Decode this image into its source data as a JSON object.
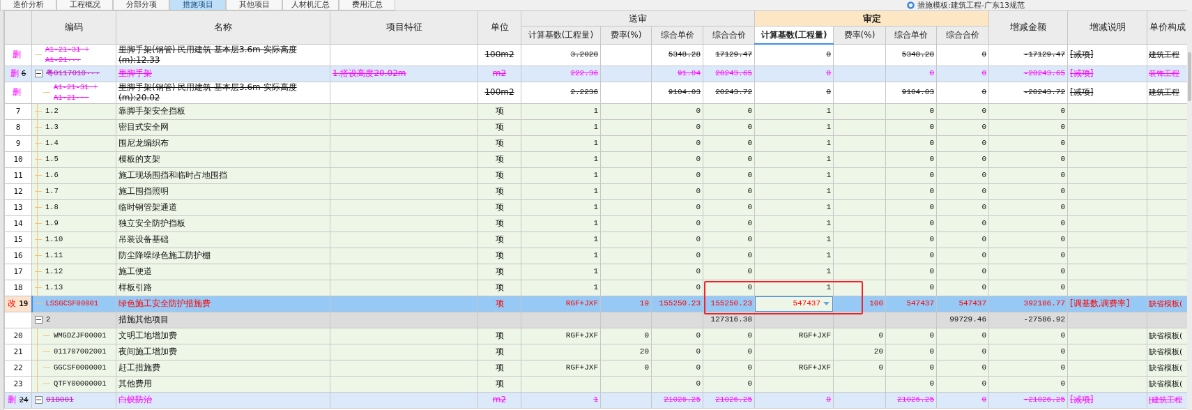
{
  "tabs": [
    {
      "label": "造价分析",
      "selected": false
    },
    {
      "label": "工程概况",
      "selected": false
    },
    {
      "label": "分部分项",
      "selected": false
    },
    {
      "label": "措施项目",
      "selected": true
    },
    {
      "label": "其他项目",
      "selected": false
    },
    {
      "label": "人材机汇总",
      "selected": false
    },
    {
      "label": "费用汇总",
      "selected": false
    }
  ],
  "template_label": "措施模板:建筑工程-广东13规范",
  "columns": [
    {
      "label": "编码"
    },
    {
      "label": "名称"
    },
    {
      "label": "项目特征"
    },
    {
      "label": "单位"
    },
    {
      "label": "送审",
      "highlighted": false,
      "subcolumns": [
        {
          "label": "计算基数(工程量)",
          "active": false
        },
        {
          "label": "费率(%)",
          "active": false
        },
        {
          "label": "综合单价",
          "active": false
        },
        {
          "label": "综合合价",
          "active": false
        }
      ]
    },
    {
      "label": "审定",
      "highlighted": true,
      "subcolumns": [
        {
          "label": "计算基数(工程量)",
          "active": true
        },
        {
          "label": "费率(%)",
          "active": false
        },
        {
          "label": "综合单价",
          "active": false
        },
        {
          "label": "综合合价",
          "active": false
        }
      ]
    },
    {
      "label": "增减金额"
    },
    {
      "label": "增减说明"
    },
    {
      "label": "单价构成"
    }
  ],
  "rows": [
    {
      "kind": "resource",
      "deleted": true,
      "modified": false,
      "mark": "删",
      "selected": false,
      "editing": false,
      "code": "A1-21-31 + A1-21···",
      "name": "里脚手架(钢管) 民用建筑 基本层3.6m  实际高度(m):12.33",
      "unit": "100m2",
      "submitted": {
        "base": "3.2028",
        "unit_price": "5348.28",
        "total": "17129.47"
      },
      "approved": {
        "base": "0",
        "unit_price": "5348.28",
        "total": "0"
      },
      "change": "-17129.47",
      "change_note": "[减项]",
      "price_composition": "建筑工程"
    },
    {
      "kind": "group",
      "deleted": true,
      "modified": false,
      "mark": "删",
      "number": "6",
      "selected": false,
      "editing": false,
      "expanded": true,
      "code": "粤0117010···",
      "name": "里脚手架",
      "feature": "1.搭设高度20.02m",
      "unit": "m2",
      "submitted": {
        "base": "222.36",
        "unit_price": "91.04",
        "total": "20243.65"
      },
      "approved": {
        "base": "0",
        "unit_price": "0",
        "total": "0"
      },
      "change": "-20243.65",
      "change_note": "[减项]",
      "price_composition": "装饰工程",
      "children": [
        {
          "kind": "resource",
          "deleted": true,
          "modified": false,
          "mark": "删",
          "selected": false,
          "editing": false,
          "code": "A1-21-31 + A1-21···",
          "name": "里脚手架(钢管) 民用建筑 基本层3.6m  实际高度(m):20.02",
          "unit": "100m2",
          "submitted": {
            "base": "2.2236",
            "unit_price": "9104.03",
            "total": "20243.72"
          },
          "approved": {
            "base": "0",
            "unit_price": "9104.03",
            "total": "0"
          },
          "change": "-20243.72",
          "change_note": "[减项]",
          "price_composition": "建筑工程"
        }
      ]
    },
    {
      "kind": "item",
      "deleted": false,
      "modified": false,
      "number": "7",
      "selected": false,
      "editing": false,
      "code": "1.2",
      "name": "靠脚手架安全挡板",
      "unit": "项",
      "submitted": {
        "base": "1",
        "unit_price": "0",
        "total": "0"
      },
      "approved": {
        "base": "1",
        "unit_price": "0",
        "total": "0"
      },
      "change": "0"
    },
    {
      "kind": "item",
      "deleted": false,
      "modified": false,
      "number": "8",
      "selected": false,
      "editing": false,
      "code": "1.3",
      "name": "密目式安全网",
      "unit": "项",
      "submitted": {
        "base": "1",
        "unit_price": "0",
        "total": "0"
      },
      "approved": {
        "base": "1",
        "unit_price": "0",
        "total": "0"
      },
      "change": "0"
    },
    {
      "kind": "item",
      "deleted": false,
      "modified": false,
      "number": "9",
      "selected": false,
      "editing": false,
      "code": "1.4",
      "name": "围尼龙编织布",
      "unit": "项",
      "submitted": {
        "base": "1",
        "unit_price": "0",
        "total": "0"
      },
      "approved": {
        "base": "1",
        "unit_price": "0",
        "total": "0"
      },
      "change": "0"
    },
    {
      "kind": "item",
      "deleted": false,
      "modified": false,
      "number": "10",
      "selected": false,
      "editing": false,
      "code": "1.5",
      "name": "模板的支架",
      "unit": "项",
      "submitted": {
        "base": "1",
        "unit_price": "0",
        "total": "0"
      },
      "approved": {
        "base": "1",
        "unit_price": "0",
        "total": "0"
      },
      "change": "0"
    },
    {
      "kind": "item",
      "deleted": false,
      "modified": false,
      "number": "11",
      "selected": false,
      "editing": false,
      "code": "1.6",
      "name": "施工现场围挡和临时占地围挡",
      "unit": "项",
      "submitted": {
        "base": "1",
        "unit_price": "0",
        "total": "0"
      },
      "approved": {
        "base": "1",
        "unit_price": "0",
        "total": "0"
      },
      "change": "0"
    },
    {
      "kind": "item",
      "deleted": false,
      "modified": false,
      "number": "12",
      "selected": false,
      "editing": false,
      "code": "1.7",
      "name": "施工围挡照明",
      "unit": "项",
      "submitted": {
        "base": "1",
        "unit_price": "0",
        "total": "0"
      },
      "approved": {
        "base": "1",
        "unit_price": "0",
        "total": "0"
      },
      "change": "0"
    },
    {
      "kind": "item",
      "deleted": false,
      "modified": false,
      "number": "13",
      "selected": false,
      "editing": false,
      "code": "1.8",
      "name": "临时钢管架通道",
      "unit": "项",
      "submitted": {
        "base": "1",
        "unit_price": "0",
        "total": "0"
      },
      "approved": {
        "base": "1",
        "unit_price": "0",
        "total": "0"
      },
      "change": "0"
    },
    {
      "kind": "item",
      "deleted": false,
      "modified": false,
      "number": "14",
      "selected": false,
      "editing": false,
      "code": "1.9",
      "name": "独立安全防护挡板",
      "unit": "项",
      "submitted": {
        "base": "1",
        "unit_price": "0",
        "total": "0"
      },
      "approved": {
        "base": "1",
        "unit_price": "0",
        "total": "0"
      },
      "change": "0"
    },
    {
      "kind": "item",
      "deleted": false,
      "modified": false,
      "number": "15",
      "selected": false,
      "editing": false,
      "code": "1.10",
      "name": "吊装设备基础",
      "unit": "项",
      "submitted": {
        "base": "1",
        "unit_price": "0",
        "total": "0"
      },
      "approved": {
        "base": "1",
        "unit_price": "0",
        "total": "0"
      },
      "change": "0"
    },
    {
      "kind": "item",
      "deleted": false,
      "modified": false,
      "number": "16",
      "selected": false,
      "editing": false,
      "code": "1.11",
      "name": "防尘降噪绿色施工防护棚",
      "unit": "项",
      "submitted": {
        "base": "1",
        "unit_price": "0",
        "total": "0"
      },
      "approved": {
        "base": "1",
        "unit_price": "0",
        "total": "0"
      },
      "change": "0"
    },
    {
      "kind": "item",
      "deleted": false,
      "modified": false,
      "number": "17",
      "selected": false,
      "editing": false,
      "code": "1.12",
      "name": "施工便道",
      "unit": "项",
      "submitted": {
        "base": "1",
        "unit_price": "0",
        "total": "0"
      },
      "approved": {
        "base": "1",
        "unit_price": "0",
        "total": "0"
      },
      "change": "0"
    },
    {
      "kind": "item",
      "deleted": false,
      "modified": false,
      "number": "18",
      "selected": false,
      "editing": false,
      "code": "1.13",
      "name": "样板引路",
      "unit": "项",
      "submitted": {
        "base": "1",
        "unit_price": "0",
        "total": "0"
      },
      "approved": {
        "base": "1",
        "unit_price": "0",
        "total": "0"
      },
      "change": "0"
    },
    {
      "kind": "item",
      "deleted": false,
      "modified": true,
      "mark": "改",
      "number": "19",
      "selected": true,
      "editing": true,
      "code": "LSSGCSF00001",
      "name": "绿色施工安全防护措施费",
      "unit": "项",
      "submitted": {
        "base": "RGF+JXF",
        "rate": "19",
        "unit_price": "155250.23",
        "total": "155250.23"
      },
      "approved": {
        "base": "547437",
        "rate": "100",
        "unit_price": "547437",
        "total": "547437"
      },
      "change": "392186.77",
      "change_note": "[调基数,调费率]",
      "price_composition": "缺省模板("
    },
    {
      "kind": "section",
      "deleted": false,
      "modified": false,
      "selected": false,
      "editing": false,
      "expanded": true,
      "code": "2",
      "name": "措施其他项目",
      "submitted": {
        "total": "127316.38"
      },
      "approved": {
        "total": "99729.46"
      },
      "change": "-27586.92",
      "children": [
        {
          "kind": "item",
          "deleted": false,
          "modified": false,
          "number": "20",
          "selected": false,
          "editing": false,
          "code": "WMGDZJF00001",
          "name": "文明工地增加费",
          "unit": "项",
          "submitted": {
            "base": "RGF+JXF",
            "rate": "0",
            "unit_price": "0",
            "total": "0"
          },
          "approved": {
            "base": "RGF+JXF",
            "rate": "0",
            "unit_price": "0",
            "total": "0"
          },
          "change": "0",
          "price_composition": "缺省模板("
        },
        {
          "kind": "item",
          "deleted": false,
          "modified": false,
          "number": "21",
          "selected": false,
          "editing": false,
          "code": "011707002001",
          "name": "夜间施工增加费",
          "unit": "项",
          "submitted": {
            "rate": "20",
            "unit_price": "0",
            "total": "0"
          },
          "approved": {
            "rate": "20",
            "unit_price": "0",
            "total": "0"
          },
          "change": "0",
          "price_composition": "缺省模板("
        },
        {
          "kind": "item",
          "deleted": false,
          "modified": false,
          "number": "22",
          "selected": false,
          "editing": false,
          "code": "GGCSF0000001",
          "name": "赶工措施费",
          "unit": "项",
          "submitted": {
            "base": "RGF+JXF",
            "rate": "0",
            "unit_price": "0",
            "total": "0"
          },
          "approved": {
            "base": "RGF+JXF",
            "rate": "0",
            "unit_price": "0",
            "total": "0"
          },
          "change": "0",
          "price_composition": "缺省模板("
        },
        {
          "kind": "item",
          "deleted": false,
          "modified": false,
          "number": "23",
          "selected": false,
          "editing": false,
          "code": "QTFY00000001",
          "name": "其他费用",
          "unit": "项",
          "submitted": {
            "unit_price": "0",
            "total": "0"
          },
          "approved": {
            "unit_price": "0",
            "total": "0"
          },
          "change": "0",
          "price_composition": "缺省模板("
        }
      ]
    },
    {
      "kind": "group",
      "deleted": true,
      "modified": false,
      "mark": "删",
      "number": "24",
      "selected": false,
      "editing": false,
      "expanded": true,
      "code": "01B001",
      "name": "白蚁防治",
      "unit": "m2",
      "submitted": {
        "base": "1",
        "unit_price": "21026.25",
        "total": "21026.25"
      },
      "approved": {
        "base": "0",
        "unit_price": "21026.25",
        "total": "0"
      },
      "change": "-21026.25",
      "change_note": "[减项]",
      "price_composition": "[建筑工程"
    }
  ],
  "annotation": {
    "kind": "rectangle"
  }
}
